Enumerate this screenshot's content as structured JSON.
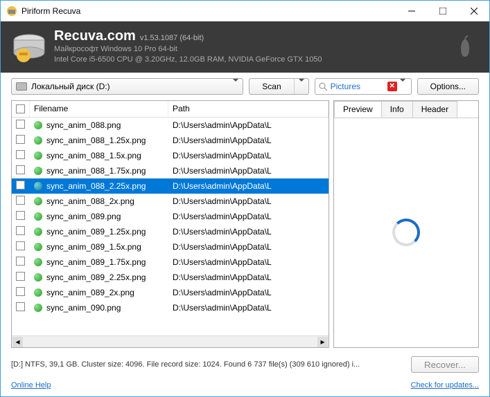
{
  "window": {
    "title": "Piriform Recuva"
  },
  "banner": {
    "brand": "Recuva",
    "brand_suffix": ".com",
    "version": "v1.53.1087 (64-bit)",
    "os": "Майкрософт Windows 10 Pro 64-bit",
    "hw": "Intel Core i5-6500 CPU @ 3.20GHz, 12.0GB RAM, NVIDIA GeForce GTX 1050"
  },
  "toolbar": {
    "drive": "Локальный диск (D:)",
    "scan_label": "Scan",
    "filter_value": "Pictures",
    "options_label": "Options..."
  },
  "columns": {
    "filename": "Filename",
    "path": "Path"
  },
  "tabs": {
    "preview": "Preview",
    "info": "Info",
    "header": "Header"
  },
  "files": [
    {
      "name": "sync_anim_088.png",
      "path": "D:\\Users\\admin\\AppData\\L",
      "selected": false
    },
    {
      "name": "sync_anim_088_1.25x.png",
      "path": "D:\\Users\\admin\\AppData\\L",
      "selected": false
    },
    {
      "name": "sync_anim_088_1.5x.png",
      "path": "D:\\Users\\admin\\AppData\\L",
      "selected": false
    },
    {
      "name": "sync_anim_088_1.75x.png",
      "path": "D:\\Users\\admin\\AppData\\L",
      "selected": false
    },
    {
      "name": "sync_anim_088_2.25x.png",
      "path": "D:\\Users\\admin\\AppData\\L",
      "selected": true
    },
    {
      "name": "sync_anim_088_2x.png",
      "path": "D:\\Users\\admin\\AppData\\L",
      "selected": false
    },
    {
      "name": "sync_anim_089.png",
      "path": "D:\\Users\\admin\\AppData\\L",
      "selected": false
    },
    {
      "name": "sync_anim_089_1.25x.png",
      "path": "D:\\Users\\admin\\AppData\\L",
      "selected": false
    },
    {
      "name": "sync_anim_089_1.5x.png",
      "path": "D:\\Users\\admin\\AppData\\L",
      "selected": false
    },
    {
      "name": "sync_anim_089_1.75x.png",
      "path": "D:\\Users\\admin\\AppData\\L",
      "selected": false
    },
    {
      "name": "sync_anim_089_2.25x.png",
      "path": "D:\\Users\\admin\\AppData\\L",
      "selected": false
    },
    {
      "name": "sync_anim_089_2x.png",
      "path": "D:\\Users\\admin\\AppData\\L",
      "selected": false
    },
    {
      "name": "sync_anim_090.png",
      "path": "D:\\Users\\admin\\AppData\\L",
      "selected": false
    }
  ],
  "status": {
    "msg": "[D:] NTFS, 39,1 GB. Cluster size: 4096. File record size: 1024. Found 6 737 file(s) (309 610 ignored) i...",
    "recover_label": "Recover..."
  },
  "footer": {
    "help": "Online Help",
    "updates": "Check for updates..."
  }
}
